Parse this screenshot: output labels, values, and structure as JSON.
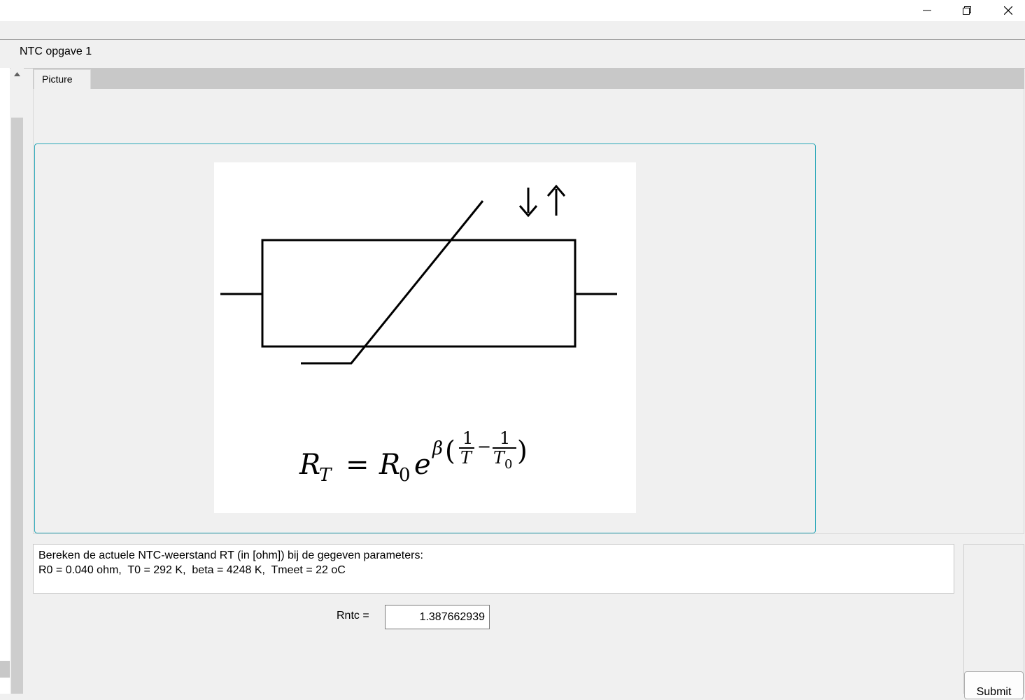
{
  "window": {
    "title": "NTC opgave 1",
    "controls": [
      "minimize",
      "maximize",
      "close"
    ]
  },
  "tabs": [
    {
      "label": "Picture",
      "selected": true
    }
  ],
  "figure": {
    "symbol": "NTC thermistor (resistor with diagonal line, arrows down/up)",
    "formula": "R_T = R_0 e^{β(1/T − 1/T_0)}"
  },
  "question": {
    "line1": "Bereken de actuele NTC-weerstand RT (in [ohm]) bij de gegeven parameters:",
    "line2": "R0 = 0.040 ohm,  T0 = 292 K,  beta = 4248 K,  Tmeet = 22 oC"
  },
  "answer": {
    "label": "Rntc =",
    "value": "1.387662939"
  },
  "submit": {
    "label": "Submit"
  },
  "colors": {
    "frame_border": "#2aa7b8",
    "background": "#f0f0f0",
    "tab_strip": "#c8c8c8"
  }
}
